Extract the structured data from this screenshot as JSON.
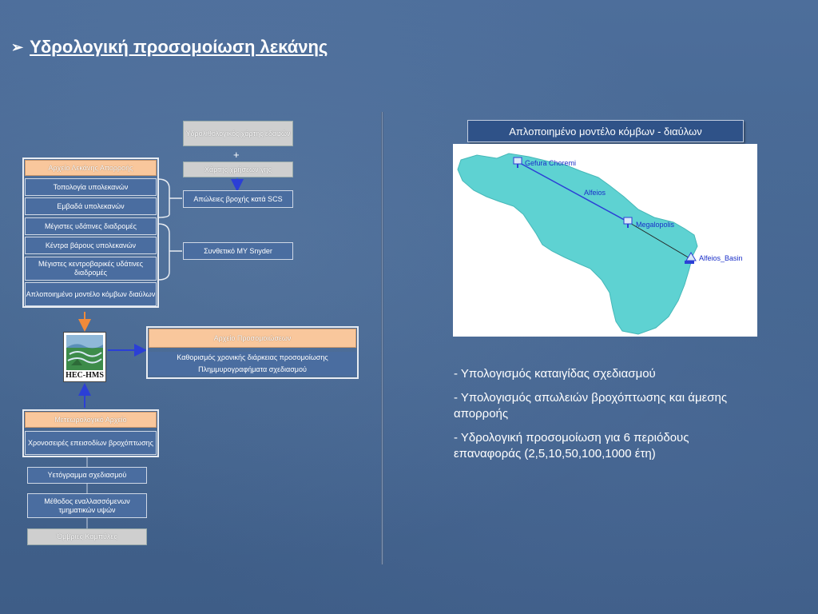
{
  "title": {
    "bullet": "➢",
    "text": "Υδρολογική προσομοίωση λεκάνης"
  },
  "center_column": {
    "soil_map": "Υδρολιθολογικός χάρτης εδαφών",
    "plus": "+",
    "land_use_map": "Χάρτης χρήσεων γης",
    "scs_losses": "Απώλειες βροχής κατά SCS",
    "snyder": "Συνθετικό ΜΥ Snyder"
  },
  "basin_file": {
    "header": "Αρχείο Λεκάνης Απορροής",
    "items": [
      "Τοπολογία υπολεκανών",
      "Εμβαδά υπολεκανών",
      "Μέγιστες υδάτινες διαδρομές",
      "Κέντρα βάρους υπολεκανών",
      "Μέγιστες κεντροβαρικές υδάτινες διαδρομές",
      "Απλοποιημένο μοντέλο κόμβων διαύλων"
    ]
  },
  "hec_hms": {
    "label": "HEC-HMS"
  },
  "simulation_file": {
    "header": "Αρχείο Προσομοιώσεων",
    "line1": "Καθορισμός χρονικής διάρκειας προσομοίωσης",
    "line2": "Πλημμυρογραφήματα σχεδιασμού"
  },
  "meteo_file": {
    "header": "Μετεωρολογικό Αρχείο",
    "item": "Χρονοσειρές επεισοδίων βροχόπτωσης"
  },
  "lower_column": {
    "hyetograph": "Υετόγραμμα σχεδιασμού",
    "alt_blocks": "Μέθοδος εναλλασσόμενων τμηματικών υψών",
    "idf": "Όμβριες Καμπύλες"
  },
  "map": {
    "title": "Απλοποιημένο μοντέλο κόμβων - διαύλων",
    "nodes": [
      "Gefura Choremi",
      "Megalopolis",
      "Alfeios_Basin"
    ],
    "reach": "Alfeios"
  },
  "bullets": [
    "- Υπολογισμός καταιγίδας σχεδιασμού",
    "- Υπολογισμός απωλειών βροχόπτωσης και άμεσης απορροής",
    "- Υδρολογική προσομοίωση για 6 περιόδους επαναφοράς (2,5,10,50,100,1000 έτη)"
  ],
  "colors": {
    "background": "#44658f",
    "orange_header": "#f9c79c",
    "basin_fill": "#5ed2d2",
    "map_title_bg": "#2f5288",
    "arrow_blue": "#2b3fd6",
    "arrow_orange": "#f08a3a"
  }
}
